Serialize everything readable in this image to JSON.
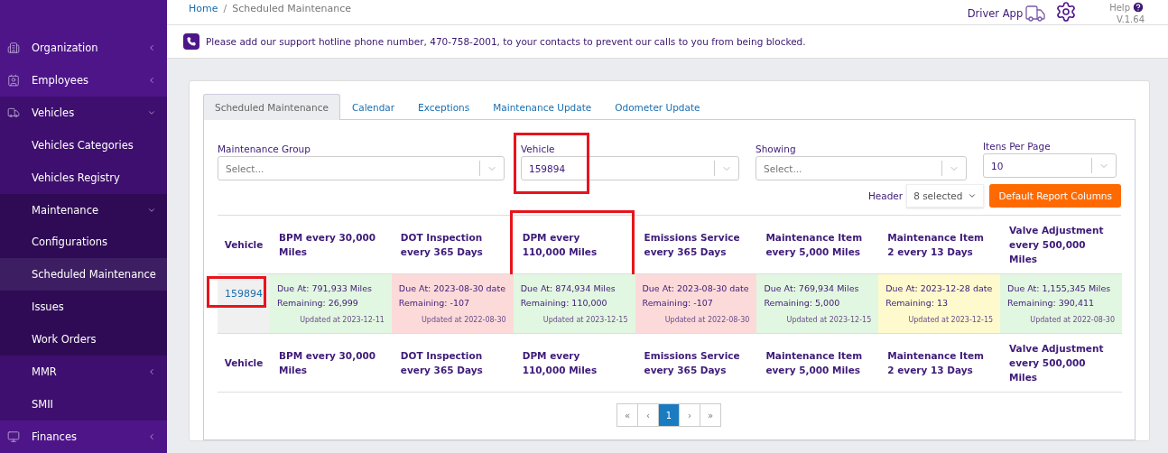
{
  "sidebar": {
    "items": [
      {
        "label": "Organization",
        "expanded": false
      },
      {
        "label": "Employees",
        "expanded": false
      },
      {
        "label": "Vehicles",
        "expanded": true,
        "children": [
          {
            "label": "Vehicles Categories",
            "selected": false
          },
          {
            "label": "Vehicles Registry",
            "selected": false
          },
          {
            "label": "Maintenance",
            "expanded": true,
            "children": [
              {
                "label": "Configurations",
                "selected": false
              },
              {
                "label": "Scheduled Maintenance",
                "selected": true
              },
              {
                "label": "Issues",
                "selected": false
              },
              {
                "label": "Work Orders",
                "selected": false
              }
            ]
          },
          {
            "label": "MMR",
            "expanded": false
          },
          {
            "label": "SMII",
            "selected": false
          }
        ]
      },
      {
        "label": "Finances",
        "expanded": false
      }
    ]
  },
  "breadcrumb": {
    "home": "Home",
    "separator": "/",
    "current": "Scheduled Maintenance"
  },
  "header": {
    "driver_app": "Driver App",
    "help": "Help",
    "version": "V.1.64"
  },
  "notice": "Please add our support hotline phone number, 470-758-2001, to your contacts to prevent our calls to you from being blocked.",
  "tabs": [
    {
      "label": "Scheduled Maintenance",
      "selected": true
    },
    {
      "label": "Calendar",
      "selected": false
    },
    {
      "label": "Exceptions",
      "selected": false
    },
    {
      "label": "Maintenance Update",
      "selected": false
    },
    {
      "label": "Odometer Update",
      "selected": false
    }
  ],
  "filters": [
    {
      "label": "Maintenance Group",
      "placeholder": "Select...",
      "highlighted": false
    },
    {
      "label": "Vehicle",
      "value": "159894",
      "highlighted": true
    },
    {
      "label": "Showing",
      "placeholder": "Select...",
      "highlighted": false
    },
    {
      "label": "Itens Per Page",
      "value": "10",
      "highlighted": false
    }
  ],
  "header_select": {
    "label": "Header",
    "value": "8 selected"
  },
  "default_button": "Default Report Columns",
  "table": {
    "columns": [
      {
        "label": "Vehicle",
        "highlighted": false
      },
      {
        "label": "BPM every 30,000 Miles",
        "highlighted": false
      },
      {
        "label": "DOT Inspection every 365 Days",
        "highlighted": false
      },
      {
        "label": "DPM every 110,000 Miles",
        "highlighted": true
      },
      {
        "label": "Emissions Service every 365 Days",
        "highlighted": false
      },
      {
        "label": "Maintenance Item every 5,000 Miles",
        "highlighted": false
      },
      {
        "label": "Maintenance Item 2 every 13 Days",
        "highlighted": false
      },
      {
        "label": "Valve Adjustment every 500,000 Miles",
        "highlighted": false
      }
    ],
    "rows": [
      {
        "cells": [
          {
            "kind": "vehicle",
            "text": "159894",
            "highlighted": true
          },
          {
            "kind": "ok",
            "due": "Due At: 791,933 Miles",
            "remaining": "Remaining: 26,999",
            "updated": "Updated at 2023-12-11"
          },
          {
            "kind": "overdue",
            "due": "Due At: 2023-08-30 date",
            "remaining": "Remaining: -107",
            "updated": "Updated at 2022-08-30"
          },
          {
            "kind": "ok",
            "due": "Due At: 874,934 Miles",
            "remaining": "Remaining: 110,000",
            "updated": "Updated at 2023-12-15"
          },
          {
            "kind": "overdue",
            "due": "Due At: 2023-08-30 date",
            "remaining": "Remaining: -107",
            "updated": "Updated at 2022-08-30"
          },
          {
            "kind": "ok",
            "due": "Due At: 769,934 Miles",
            "remaining": "Remaining: 5,000",
            "updated": "Updated at 2023-12-15"
          },
          {
            "kind": "soon",
            "due": "Due At: 2023-12-28 date",
            "remaining": "Remaining: 13",
            "updated": "Updated at 2023-12-15"
          },
          {
            "kind": "ok",
            "due": "Due At: 1,155,345 Miles",
            "remaining": "Remaining: 390,411",
            "updated": "Updated at 2022-08-30"
          }
        ]
      }
    ],
    "footer_columns": [
      "Vehicle",
      "BPM every 30,000 Miles",
      "DOT Inspection every 365 Days",
      "DPM every 110,000 Miles",
      "Emissions Service every 365 Days",
      "Maintenance Item every 5,000 Miles",
      "Maintenance Item 2 every 13 Days",
      "Valve Adjustment every 500,000 Miles"
    ]
  },
  "pagination": [
    {
      "label": "«",
      "selected": false
    },
    {
      "label": "‹",
      "selected": false
    },
    {
      "label": "1",
      "selected": true
    },
    {
      "label": "›",
      "selected": false
    },
    {
      "label": "»",
      "selected": false
    }
  ]
}
